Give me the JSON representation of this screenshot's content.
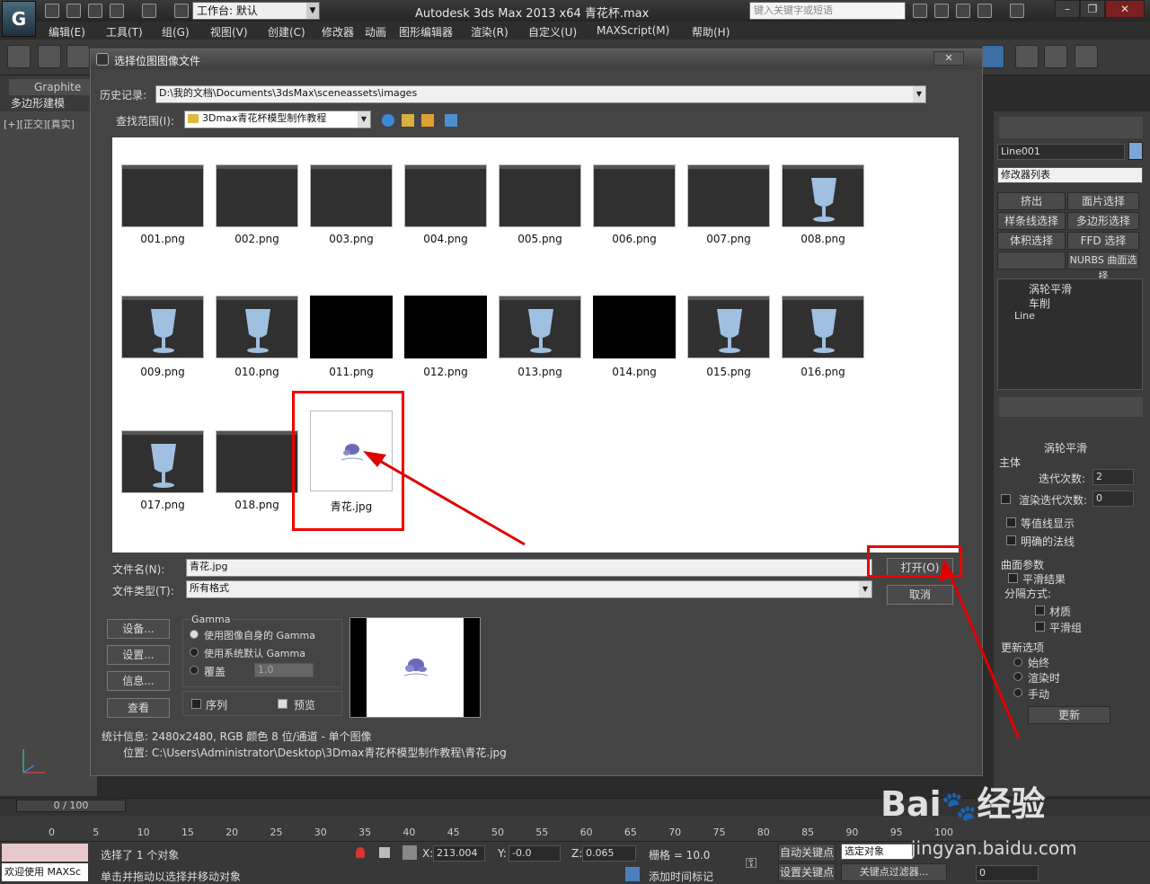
{
  "app": {
    "title": "Autodesk 3ds Max  2013 x64      青花杯.max",
    "workspace": "工作台: 默认",
    "search_placeholder": "键入关键字或短语",
    "logo": "G",
    "minimize": "–",
    "restore": "❐",
    "close": "✕"
  },
  "menu": [
    "编辑(E)",
    "工具(T)",
    "组(G)",
    "视图(V)",
    "创建(C)",
    "修改器",
    "动画",
    "图形编辑器",
    "渲染(R)",
    "自定义(U)",
    "MAXScript(M)",
    "帮助(H)"
  ],
  "ribbon": {
    "graphite_tab": "Graphite",
    "poly_tab": "多边形建模",
    "viewport_label": "[+][正交][真实]"
  },
  "dialog": {
    "title": "选择位图图像文件",
    "close": "✕",
    "history_label": "历史记录:",
    "history_value": "D:\\我的文档\\Documents\\3dsMax\\sceneassets\\images",
    "lookin_label": "查找范围(I):",
    "lookin_value": "3Dmax青花杯模型制作教程",
    "files": [
      {
        "name": "001.png",
        "kind": "screen"
      },
      {
        "name": "002.png",
        "kind": "screen"
      },
      {
        "name": "003.png",
        "kind": "screen"
      },
      {
        "name": "004.png",
        "kind": "screen"
      },
      {
        "name": "005.png",
        "kind": "screen"
      },
      {
        "name": "006.png",
        "kind": "screen"
      },
      {
        "name": "007.png",
        "kind": "screen"
      },
      {
        "name": "008.png",
        "kind": "cup"
      },
      {
        "name": "009.png",
        "kind": "cup"
      },
      {
        "name": "010.png",
        "kind": "cup"
      },
      {
        "name": "011.png",
        "kind": "black"
      },
      {
        "name": "012.png",
        "kind": "black"
      },
      {
        "name": "013.png",
        "kind": "cup"
      },
      {
        "name": "014.png",
        "kind": "black"
      },
      {
        "name": "015.png",
        "kind": "cup"
      },
      {
        "name": "016.png",
        "kind": "cup"
      },
      {
        "name": "017.png",
        "kind": "cup"
      },
      {
        "name": "018.png",
        "kind": "screen"
      },
      {
        "name": "青花.jpg",
        "kind": "flower"
      }
    ],
    "filename_label": "文件名(N):",
    "filename_value": "青花.jpg",
    "filetype_label": "文件类型(T):",
    "filetype_value": "所有格式",
    "open_button": "打开(O)",
    "cancel_button": "取消",
    "setup_button": "设备...",
    "settings_button": "设置...",
    "info_button": "信息...",
    "view_button": "查看",
    "gamma_title": "Gamma",
    "gamma_options": [
      "使用图像自身的 Gamma",
      "使用系统默认 Gamma",
      "覆盖"
    ],
    "gamma_override_value": "1.0",
    "sequence_label": "序列",
    "preview_label": "预览",
    "stats": "统计信息: 2480x2480, RGB 颜色 8 位/通道 - 单个图像",
    "location": "位置: C:\\Users\\Administrator\\Desktop\\3Dmax青花杯模型制作教程\\青花.jpg"
  },
  "command_panel": {
    "object_name": "Line001",
    "modifier_list": "修改器列表",
    "buttons": [
      "挤出",
      "面片选择",
      "样条线选择",
      "多边形选择",
      "体积选择",
      "FFD 选择",
      "",
      "NURBS 曲面选择"
    ],
    "stack": [
      "涡轮平滑",
      "车削",
      "Line"
    ],
    "rollout_title": "涡轮平滑",
    "main_label": "主体",
    "iterations_label": "迭代次数:",
    "iterations_value": "2",
    "render_iters_label": "渲染迭代次数:",
    "render_iters_value": "0",
    "isoline_label": "等值线显示",
    "explicit_normals_label": "明确的法线",
    "surface_label": "曲面参数",
    "smooth_result_label": "平滑结果",
    "separate_label": "分隔方式:",
    "material_label": "材质",
    "smoothing_group_label": "平滑组",
    "update_label": "更新选项",
    "update_options": [
      "始终",
      "渲染时",
      "手动"
    ],
    "update_button": "更新"
  },
  "timeline": {
    "frame": "0 / 100",
    "ticks": [
      "0",
      "5",
      "10",
      "15",
      "20",
      "25",
      "30",
      "35",
      "40",
      "45",
      "50",
      "55",
      "60",
      "65",
      "70",
      "75",
      "80",
      "85",
      "90",
      "95",
      "100"
    ]
  },
  "status": {
    "welcome": "欢迎使用 MAXSc",
    "selected": "选择了 1 个对象",
    "prompt": "单击并拖动以选择并移动对象",
    "x": "213.004",
    "y": "-0.0",
    "z": "0.065",
    "grid": "栅格 = 10.0",
    "auto_key": "自动关键点",
    "set_key": "设置关键点",
    "selected_object": "选定对象",
    "key_filter": "关键点过滤器...",
    "add_time_tag": "添加时间标记",
    "frame_value": "0"
  },
  "watermark": {
    "brand": "Bai",
    "brand2": "经验",
    "url": "jingyan.baidu.com"
  },
  "colors": {
    "highlight_red": "#e00000",
    "bg": "#2b2b2b"
  }
}
